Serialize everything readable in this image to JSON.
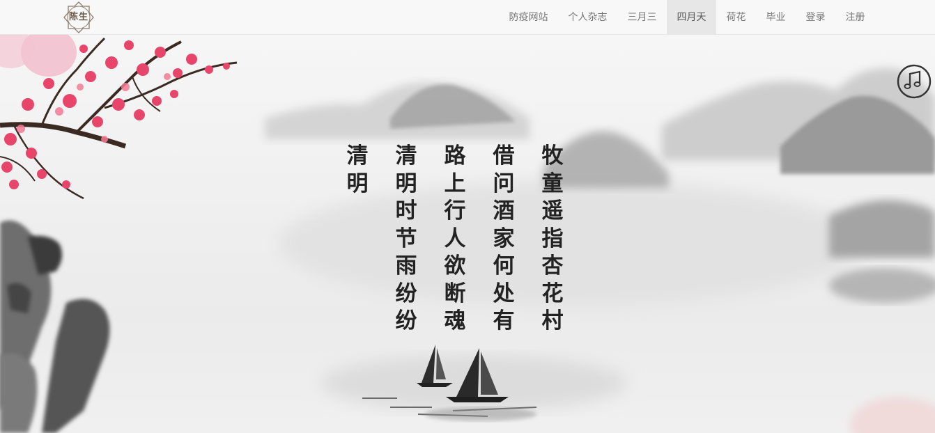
{
  "brand": {
    "text": "陈生"
  },
  "nav": {
    "items": [
      {
        "label": "防疫网站",
        "active": false
      },
      {
        "label": "个人杂志",
        "active": false
      },
      {
        "label": "三月三",
        "active": false
      },
      {
        "label": "四月天",
        "active": true
      },
      {
        "label": "荷花",
        "active": false
      },
      {
        "label": "毕业",
        "active": false
      },
      {
        "label": "登录",
        "active": false
      },
      {
        "label": "注册",
        "active": false
      }
    ]
  },
  "poem": {
    "columns": [
      "牧童遥指杏花村",
      "借问酒家何处有",
      "路上行人欲断魂",
      "清明时节雨纷纷",
      "清明"
    ]
  },
  "music": {
    "icon": "music-note-icon"
  },
  "colors": {
    "nav_bg": "#f8f8f8",
    "nav_active_bg": "#e7e7e7",
    "nav_text": "#777777",
    "blossom": "#e8456b",
    "ink": "#222222"
  }
}
